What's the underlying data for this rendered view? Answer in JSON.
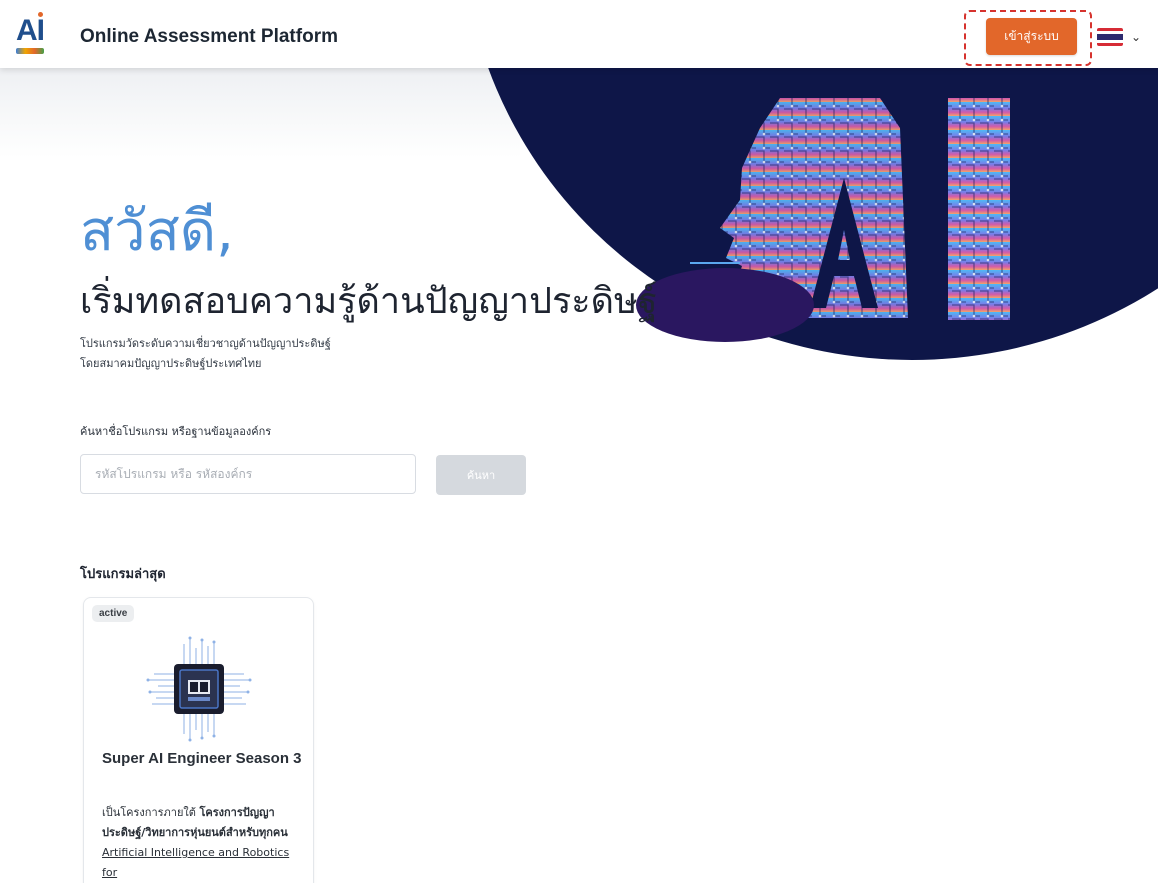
{
  "header": {
    "app_title": "Online Assessment Platform",
    "login_label": "เข้าสู่ระบบ",
    "language": "Thai",
    "logo_text": "AI"
  },
  "hero": {
    "greeting": "สวัสดี,",
    "headline": "เริ่มทดสอบความรู้ด้านปัญญาประดิษฐ์",
    "subtext_line1": "โปรแกรมวัดระดับความเชี่ยวชาญด้านปัญญาประดิษฐ์",
    "subtext_line2": "โดยสมาคมปัญญาประดิษฐ์ประเทศไทย",
    "art_text": "AI"
  },
  "search": {
    "label": "ค้นหาชื่อโปรแกรม หรือฐานข้อมูลองค์กร",
    "placeholder": "รหัสโปรแกรม หรือ รหัสองค์กร",
    "value": "",
    "button_label": "ค้นหา"
  },
  "programs": {
    "section_title": "โปรแกรมล่าสุด",
    "items": [
      {
        "status": "active",
        "title": "Super AI Engineer Season 3",
        "desc_prefix": "เป็นโครงการภายใต้ ",
        "desc_bold": "โครงการปัญญาประดิษฐ์/วิทยาการหุ่นยนต์สำหรับทุกคน",
        "desc_link": "Artificial Intelligence and Robotics for"
      }
    ]
  },
  "colors": {
    "accent_orange": "#e2672a",
    "greeting_blue": "#4f8fd4",
    "hero_navy": "#0e1648"
  },
  "icons": {
    "language_flag": "thailand-flag-icon",
    "dropdown": "chevron-down-icon",
    "program_image": "ai-chip-icon"
  }
}
